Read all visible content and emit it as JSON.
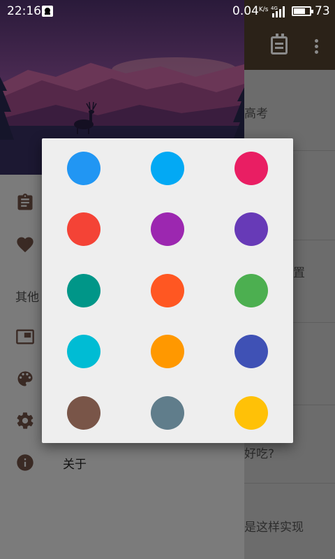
{
  "status_bar": {
    "time": "22:16",
    "net_speed": "0.04",
    "net_speed_unit": "K/s",
    "network_type": "4G",
    "battery_level": "73"
  },
  "toolbar": {
    "calendar_icon": "calendar-icon",
    "overflow_icon": "overflow-menu-icon"
  },
  "background_list": {
    "items": [
      "高考",
      "置",
      "好吃?",
      "是这样实现"
    ]
  },
  "drawer": {
    "section_other": "其他",
    "items": [
      {
        "icon": "clipboard-icon",
        "label": ""
      },
      {
        "icon": "heart-icon",
        "label": ""
      },
      {
        "icon": "picture-in-picture-icon",
        "label": ""
      },
      {
        "icon": "palette-icon",
        "label": ""
      },
      {
        "icon": "settings-icon",
        "label": ""
      },
      {
        "icon": "info-icon",
        "label": "关于"
      }
    ]
  },
  "color_picker": {
    "colors": [
      "#2196F3",
      "#03A9F4",
      "#E91E63",
      "#F44336",
      "#9C27B0",
      "#673AB7",
      "#009688",
      "#FF5722",
      "#4CAF50",
      "#00BCD4",
      "#FF9800",
      "#3F51B5",
      "#795548",
      "#607D8B",
      "#FFC107"
    ]
  },
  "colors": {
    "drawer_icon": "#3a2a24",
    "toolbar": "#2b2218",
    "dialog_bg": "#eeeeee"
  }
}
